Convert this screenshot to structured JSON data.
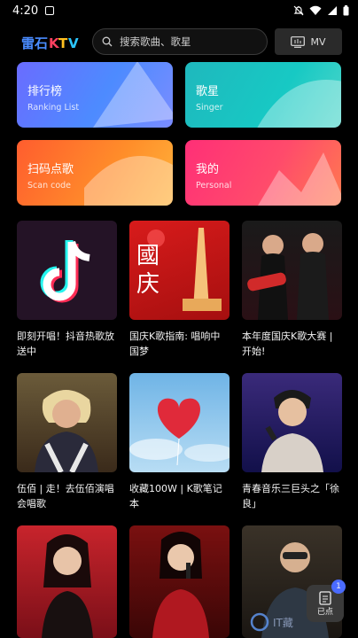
{
  "status": {
    "time": "4:20"
  },
  "header": {
    "search_placeholder": "搜索歌曲、歌星",
    "mv_label": "MV"
  },
  "categories": [
    {
      "title": "排行榜",
      "subtitle": "Ranking List"
    },
    {
      "title": "歌星",
      "subtitle": "Singer"
    },
    {
      "title": "扫码点歌",
      "subtitle": "Scan code"
    },
    {
      "title": "我的",
      "subtitle": "Personal"
    }
  ],
  "cards": [
    {
      "title": "即刻开唱！抖音热歌放送中"
    },
    {
      "title": "国庆K歌指南: 唱响中国梦",
      "image_text": "國庆"
    },
    {
      "title": "本年度国庆K歌大赛 | 开始!"
    },
    {
      "title": "伍佰 | 走！去伍佰演唱会唱歌"
    },
    {
      "title": "收藏100W | K歌笔记本"
    },
    {
      "title": "青春音乐三巨头之「徐良」"
    },
    {
      "title": ""
    },
    {
      "title": ""
    },
    {
      "title": ""
    }
  ],
  "float_button": {
    "label": "已点",
    "badge": "1"
  },
  "watermark": {
    "text": "IT藏"
  },
  "colors": {
    "background": "#000000",
    "accent": "#4a6bff"
  }
}
